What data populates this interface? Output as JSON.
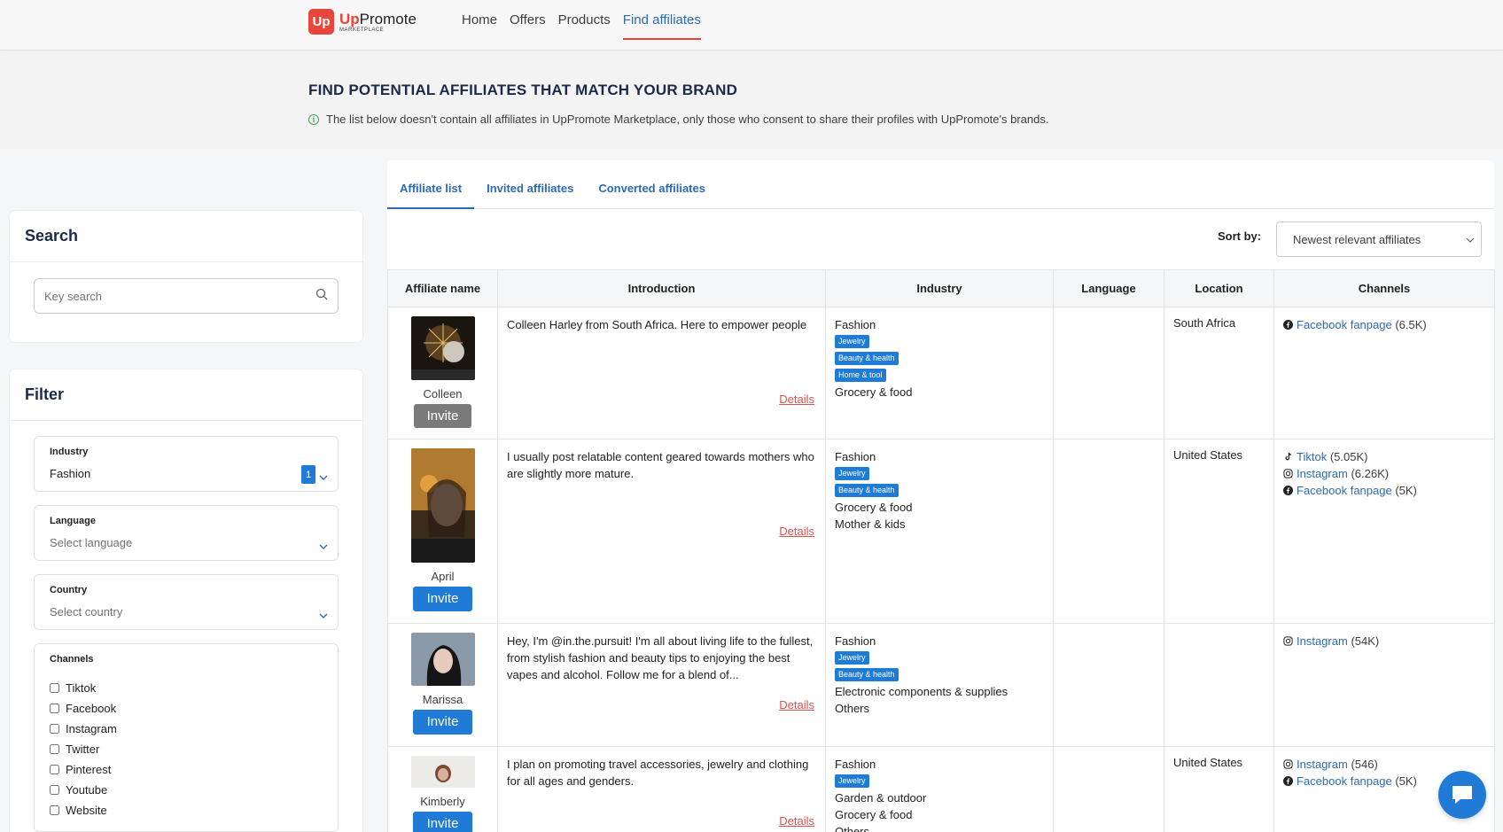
{
  "header": {
    "logo_mark": "Up",
    "logo_name_accent": "Up",
    "logo_name_rest": "Promote",
    "logo_sub": "MARKETPLACE",
    "nav": [
      "Home",
      "Offers",
      "Products",
      "Find affiliates"
    ],
    "active_nav": "Find affiliates"
  },
  "page": {
    "title": "FIND POTENTIAL AFFILIATES THAT MATCH YOUR BRAND",
    "note": "The list below doesn't contain all affiliates in UpPromote Marketplace, only those who consent to share their profiles with UpPromote's brands."
  },
  "search": {
    "title": "Search",
    "placeholder": "Key search"
  },
  "filter": {
    "title": "Filter",
    "industry": {
      "label": "Industry",
      "value": "Fashion",
      "count": "1"
    },
    "language": {
      "label": "Language",
      "placeholder": "Select language"
    },
    "country": {
      "label": "Country",
      "placeholder": "Select country"
    },
    "channels": {
      "label": "Channels",
      "options": [
        "Tiktok",
        "Facebook",
        "Instagram",
        "Twitter",
        "Pinterest",
        "Youtube",
        "Website"
      ]
    }
  },
  "tabs": [
    "Affiliate list",
    "Invited affiliates",
    "Converted affiliates"
  ],
  "sort": {
    "label": "Sort by:",
    "value": "Newest relevant affiliates"
  },
  "table": {
    "headers": [
      "Affiliate name",
      "Introduction",
      "Industry",
      "Language",
      "Location",
      "Channels"
    ],
    "details_label": "Details",
    "invite_label": "Invite",
    "rows": [
      {
        "name": "Colleen",
        "intro": "Colleen Harley from South Africa. Here to empower people",
        "industry_top": "Fashion",
        "tags": [
          "Jewelry",
          "Beauty & health",
          "Home & tool"
        ],
        "industry_bottom": [
          "Grocery & food"
        ],
        "language": "",
        "location": "South Africa",
        "channels": [
          {
            "icon": "facebook-icon",
            "name": "Facebook fanpage",
            "count": "(6.5K)"
          }
        ]
      },
      {
        "name": "April",
        "intro": "I usually post relatable content geared towards mothers who are slightly more mature.",
        "industry_top": "Fashion",
        "tags": [
          "Jewelry",
          "Beauty & health"
        ],
        "industry_bottom": [
          "Grocery & food",
          "Mother & kids"
        ],
        "language": "",
        "location": "United States",
        "channels": [
          {
            "icon": "tiktok-icon",
            "name": "Tiktok",
            "count": "(5.05K)"
          },
          {
            "icon": "instagram-icon",
            "name": "Instagram",
            "count": "(6.26K)"
          },
          {
            "icon": "facebook-icon",
            "name": "Facebook fanpage",
            "count": "(5K)"
          }
        ]
      },
      {
        "name": "Marissa",
        "intro": "Hey, I'm @in.the.pursuit! I'm all about living life to the fullest, from stylish fashion and beauty tips to enjoying the best vapes and alcohol. Follow me for a blend of...",
        "industry_top": "Fashion",
        "tags": [
          "Jewelry",
          "Beauty & health"
        ],
        "industry_bottom": [
          "Electronic components & supplies",
          "Others"
        ],
        "language": "",
        "location": "",
        "channels": [
          {
            "icon": "instagram-icon",
            "name": "Instagram",
            "count": "(54K)"
          }
        ]
      },
      {
        "name": "Kimberly",
        "intro": "I plan on promoting travel accessories, jewelry and clothing for all ages and genders.",
        "industry_top": "Fashion",
        "tags": [
          "Jewelry"
        ],
        "industry_bottom": [
          "Garden & outdoor",
          "Grocery & food",
          "Others"
        ],
        "language": "",
        "location": "United States",
        "channels": [
          {
            "icon": "instagram-icon",
            "name": "Instagram",
            "count": "(546)"
          },
          {
            "icon": "facebook-icon",
            "name": "Facebook fanpage",
            "count": "(5K)"
          }
        ]
      }
    ]
  },
  "colors": {
    "brand": "#e8453c",
    "primary": "#1f7bd6",
    "link": "#2d6ab0",
    "details": "#d9534f"
  }
}
